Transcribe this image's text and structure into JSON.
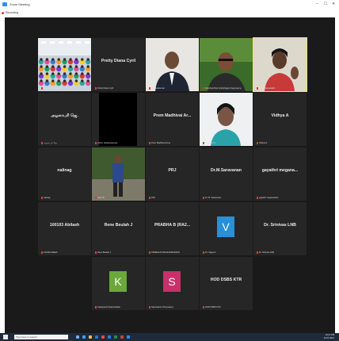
{
  "window": {
    "title": "Zoom Meeting",
    "menu_label": "Recording",
    "minimize": "–",
    "maximize": "☐",
    "close": "✕"
  },
  "accent": {
    "active_speaker": "#e8e85a",
    "muted_mic": "#e33333",
    "letter_k": "#6aa83a",
    "letter_s": "#c8306a",
    "letter_v": "#2a8fd6"
  },
  "tiles": [
    {
      "id": "t1",
      "name": "",
      "caption": "Aniket Sivashankar",
      "kind": "video-classroom"
    },
    {
      "id": "t2",
      "name": "Pretty Diana Cyril",
      "caption": "Pretty Diana Cyril",
      "kind": "name"
    },
    {
      "id": "t3",
      "name": "",
      "caption": "Mr. Ravikumar",
      "kind": "video-man"
    },
    {
      "id": "t4",
      "name": "",
      "caption": "Kanchambhar Anbazhagan Kuppusamy",
      "kind": "video-man2"
    },
    {
      "id": "t5",
      "name": "",
      "caption": "Dr. S. Saraswathi",
      "kind": "video-woman"
    },
    {
      "id": "t6",
      "name": "அழகாபுரி ஜெ.",
      "caption": "அழகாபுரி ஜெ.",
      "kind": "name"
    },
    {
      "id": "t7",
      "name": "",
      "caption": "Arthur Sahasranaman",
      "kind": "black"
    },
    {
      "id": "t8",
      "name": "Prem Madhivai Ar...",
      "caption": "Prem Madhivai Anna",
      "kind": "name"
    },
    {
      "id": "t9",
      "name": "",
      "caption": "Umarani M",
      "kind": "video-portrait"
    },
    {
      "id": "t10",
      "name": "Vidhya A",
      "caption": "Vidhya A",
      "kind": "name"
    },
    {
      "id": "t11",
      "name": "nalinag",
      "caption": "nalinag",
      "kind": "name"
    },
    {
      "id": "t12",
      "name": "",
      "caption": "Jenin B",
      "kind": "video-standing"
    },
    {
      "id": "t13",
      "name": "PRJ",
      "caption": "PRJ",
      "kind": "name"
    },
    {
      "id": "t14",
      "name": "Dr.M.Saravanan",
      "caption": "Dr. M. Saravanan",
      "kind": "name"
    },
    {
      "id": "t15",
      "name": "gayathri megana...",
      "caption": "gayathri meganathan",
      "kind": "name"
    },
    {
      "id": "t16",
      "name": "100103 Abilash",
      "caption": "100103 Abilash",
      "kind": "name"
    },
    {
      "id": "t17",
      "name": "Rene Beulah J",
      "caption": "Rene Beulah J",
      "kind": "name"
    },
    {
      "id": "t18",
      "name": "PRABHA B (RA2...",
      "caption": "PRABHA B RA2113032010002",
      "kind": "name"
    },
    {
      "id": "t19",
      "name": "V",
      "caption": "Dr. Vijaya K",
      "kind": "letter-v"
    },
    {
      "id": "t20",
      "name": "Dr. Srinivas LNB",
      "caption": "Dr. Srinivas LNB",
      "kind": "name"
    },
    {
      "id": "t21",
      "name": "K",
      "caption": "Kalaiyarasi Swaminathan",
      "kind": "letter-k"
    },
    {
      "id": "t22",
      "name": "S",
      "caption": "Sasanakum Periyasamy",
      "kind": "letter-s"
    },
    {
      "id": "t23",
      "name": "HOD DSBS KTR",
      "caption": "HOD DSBS KTR",
      "kind": "name"
    }
  ],
  "taskbar": {
    "search_placeholder": "Type here to search",
    "clock_time": "10:27 PM",
    "clock_date": "24-07-2021"
  }
}
